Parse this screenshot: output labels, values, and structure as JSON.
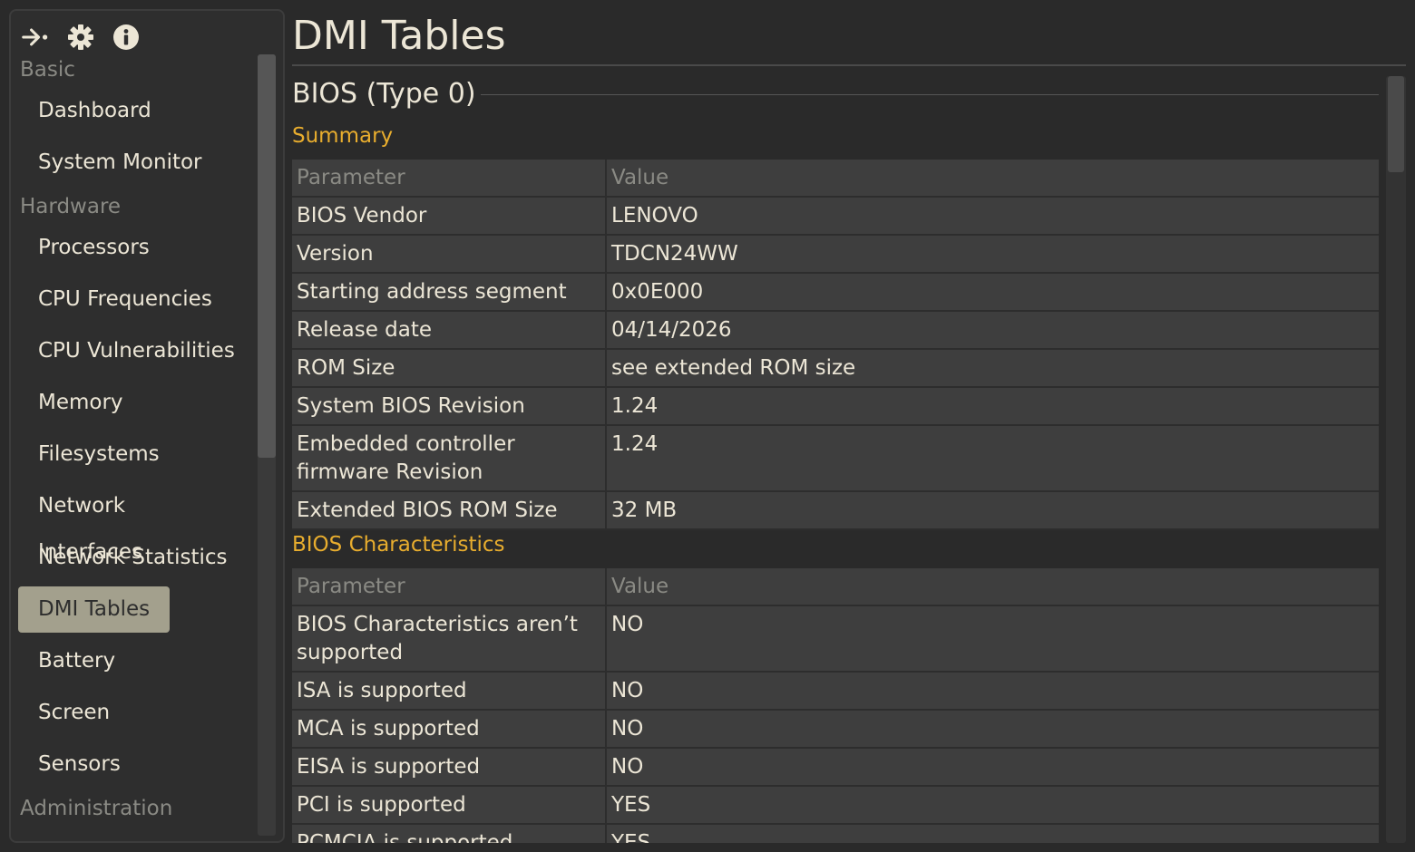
{
  "toolbar": {
    "icons": [
      "expand-arrow-icon",
      "gear-icon",
      "info-icon"
    ]
  },
  "sidebar": {
    "groups": [
      {
        "heading": "Basic",
        "items": [
          "Dashboard",
          "System Monitor"
        ]
      },
      {
        "heading": "Hardware",
        "items": [
          "Processors",
          "CPU Frequencies",
          "CPU Vulnerabilities",
          "Memory",
          "Filesystems",
          "Network Interfaces",
          "Network Statistics",
          "DMI Tables",
          "Battery",
          "Screen",
          "Sensors"
        ]
      },
      {
        "heading": "Administration",
        "items": []
      }
    ],
    "active_item": "DMI Tables"
  },
  "page": {
    "title": "DMI Tables",
    "section_title": "BIOS (Type 0)",
    "summary": {
      "title": "Summary",
      "header": {
        "param": "Parameter",
        "value": "Value"
      },
      "rows": [
        {
          "param": "BIOS Vendor",
          "value": "LENOVO"
        },
        {
          "param": "Version",
          "value": "TDCN24WW"
        },
        {
          "param": "Starting address segment",
          "value": "0x0E000"
        },
        {
          "param": "Release date",
          "value": "04/14/2026"
        },
        {
          "param": "ROM Size",
          "value": "see extended ROM size"
        },
        {
          "param": "System BIOS Revision",
          "value": "1.24"
        },
        {
          "param": "Embedded controller firmware Revision",
          "value": "1.24"
        },
        {
          "param": "Extended BIOS ROM Size",
          "value": "32 MB"
        }
      ]
    },
    "characteristics": {
      "title": "BIOS Characteristics",
      "header": {
        "param": "Parameter",
        "value": "Value"
      },
      "rows": [
        {
          "param": "BIOS Characteristics aren’t supported",
          "value": "NO"
        },
        {
          "param": "ISA is supported",
          "value": "NO"
        },
        {
          "param": "MCA is supported",
          "value": "NO"
        },
        {
          "param": "EISA is supported",
          "value": "NO"
        },
        {
          "param": "PCI is supported",
          "value": "YES"
        },
        {
          "param": "PCMCIA is supported",
          "value": "YES"
        }
      ]
    }
  },
  "colors": {
    "background": "#2a2a2a",
    "accent_subtitle": "#e8ad2e",
    "active_nav": "#a3a08d",
    "text": "#ece6d6",
    "muted_text": "#8a8a84"
  }
}
